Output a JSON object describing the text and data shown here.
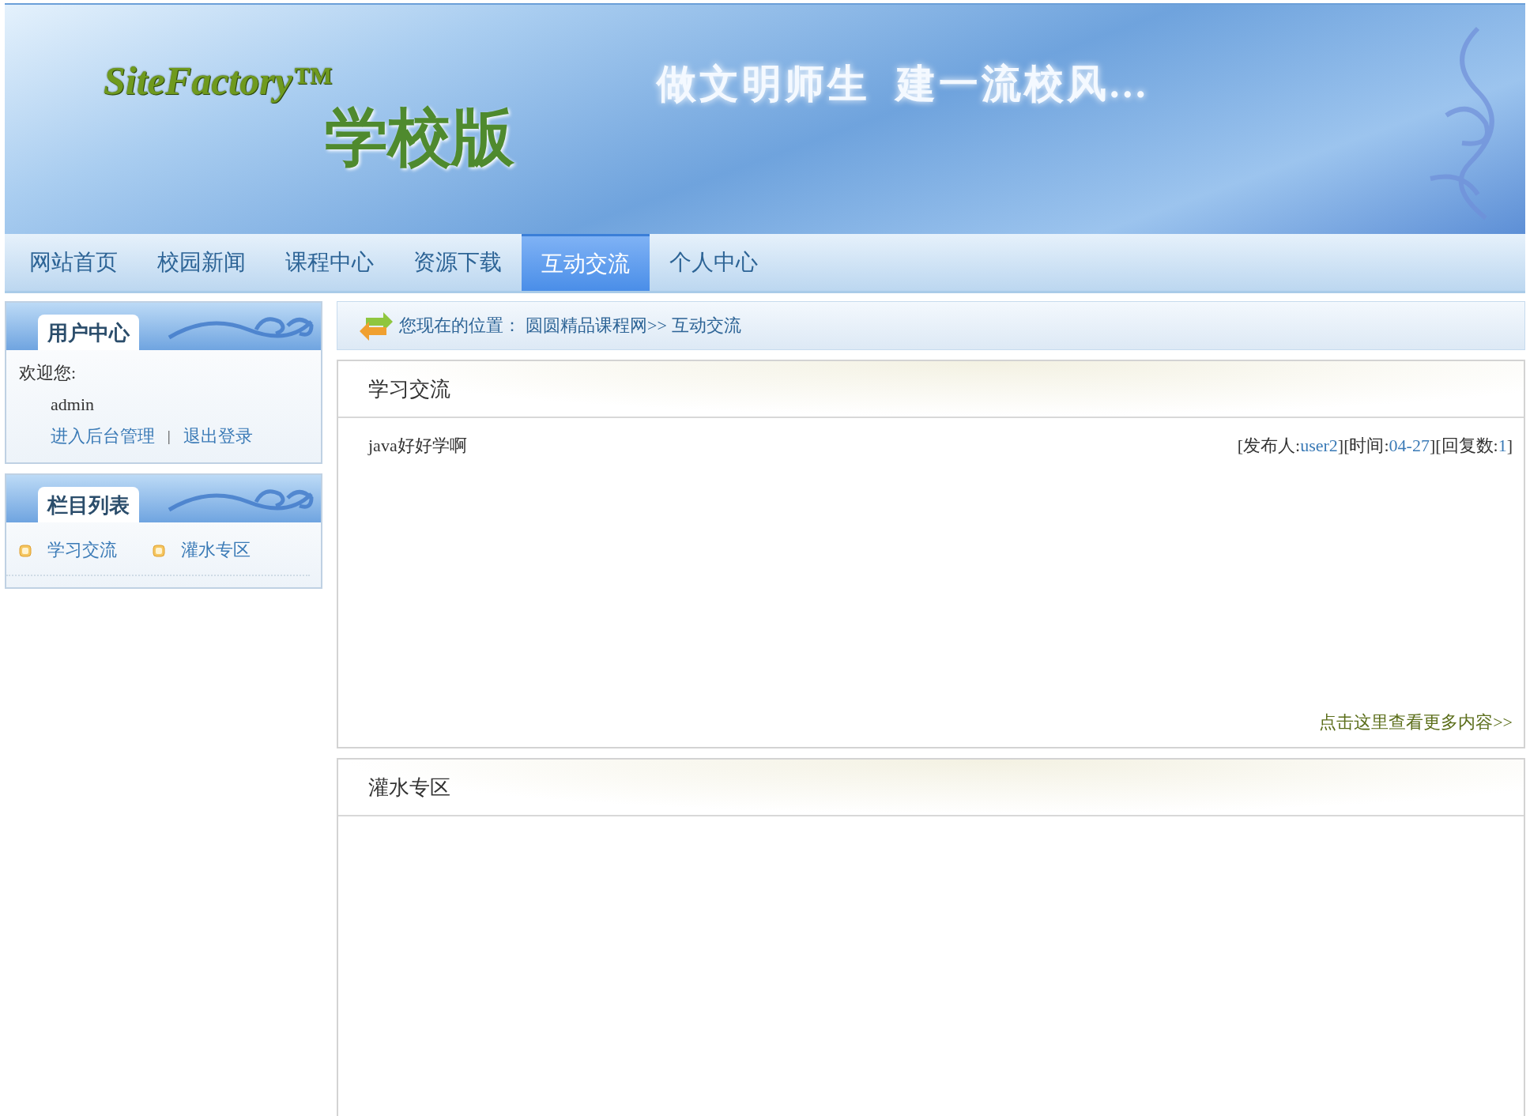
{
  "banner": {
    "logo": "SiteFactory™",
    "edition": "学校版",
    "slogan": "做文明师生  建一流校风..."
  },
  "nav": [
    {
      "label": "网站首页",
      "selected": false
    },
    {
      "label": "校园新闻",
      "selected": false
    },
    {
      "label": "课程中心",
      "selected": false
    },
    {
      "label": "资源下载",
      "selected": false
    },
    {
      "label": "互动交流",
      "selected": true
    },
    {
      "label": "个人中心",
      "selected": false
    }
  ],
  "user_center": {
    "title": "用户中心",
    "welcome": "欢迎您:",
    "username": "admin",
    "links": [
      "进入后台管理",
      "退出登录"
    ],
    "separator": "|"
  },
  "column_list": {
    "title": "栏目列表",
    "items": [
      "学习交流",
      "灌水专区"
    ]
  },
  "breadcrumb": {
    "label": "您现在的位置：",
    "links": [
      "圆圆精品课程网>>",
      "互动交流"
    ]
  },
  "sections": [
    {
      "title": "学习交流",
      "posts": [
        {
          "title": "java好好学啊",
          "meta": [
            {
              "kind": "plain",
              "text": "[发布人:"
            },
            {
              "kind": "link",
              "text": "user2"
            },
            {
              "kind": "plain",
              "text": "][时间:"
            },
            {
              "kind": "link",
              "text": "04-27"
            },
            {
              "kind": "plain",
              "text": "][回复数:"
            },
            {
              "kind": "link",
              "text": "1"
            },
            {
              "kind": "plain",
              "text": "]"
            }
          ]
        }
      ],
      "more": "点击这里查看更多内容>>"
    },
    {
      "title": "灌水专区"
    }
  ]
}
